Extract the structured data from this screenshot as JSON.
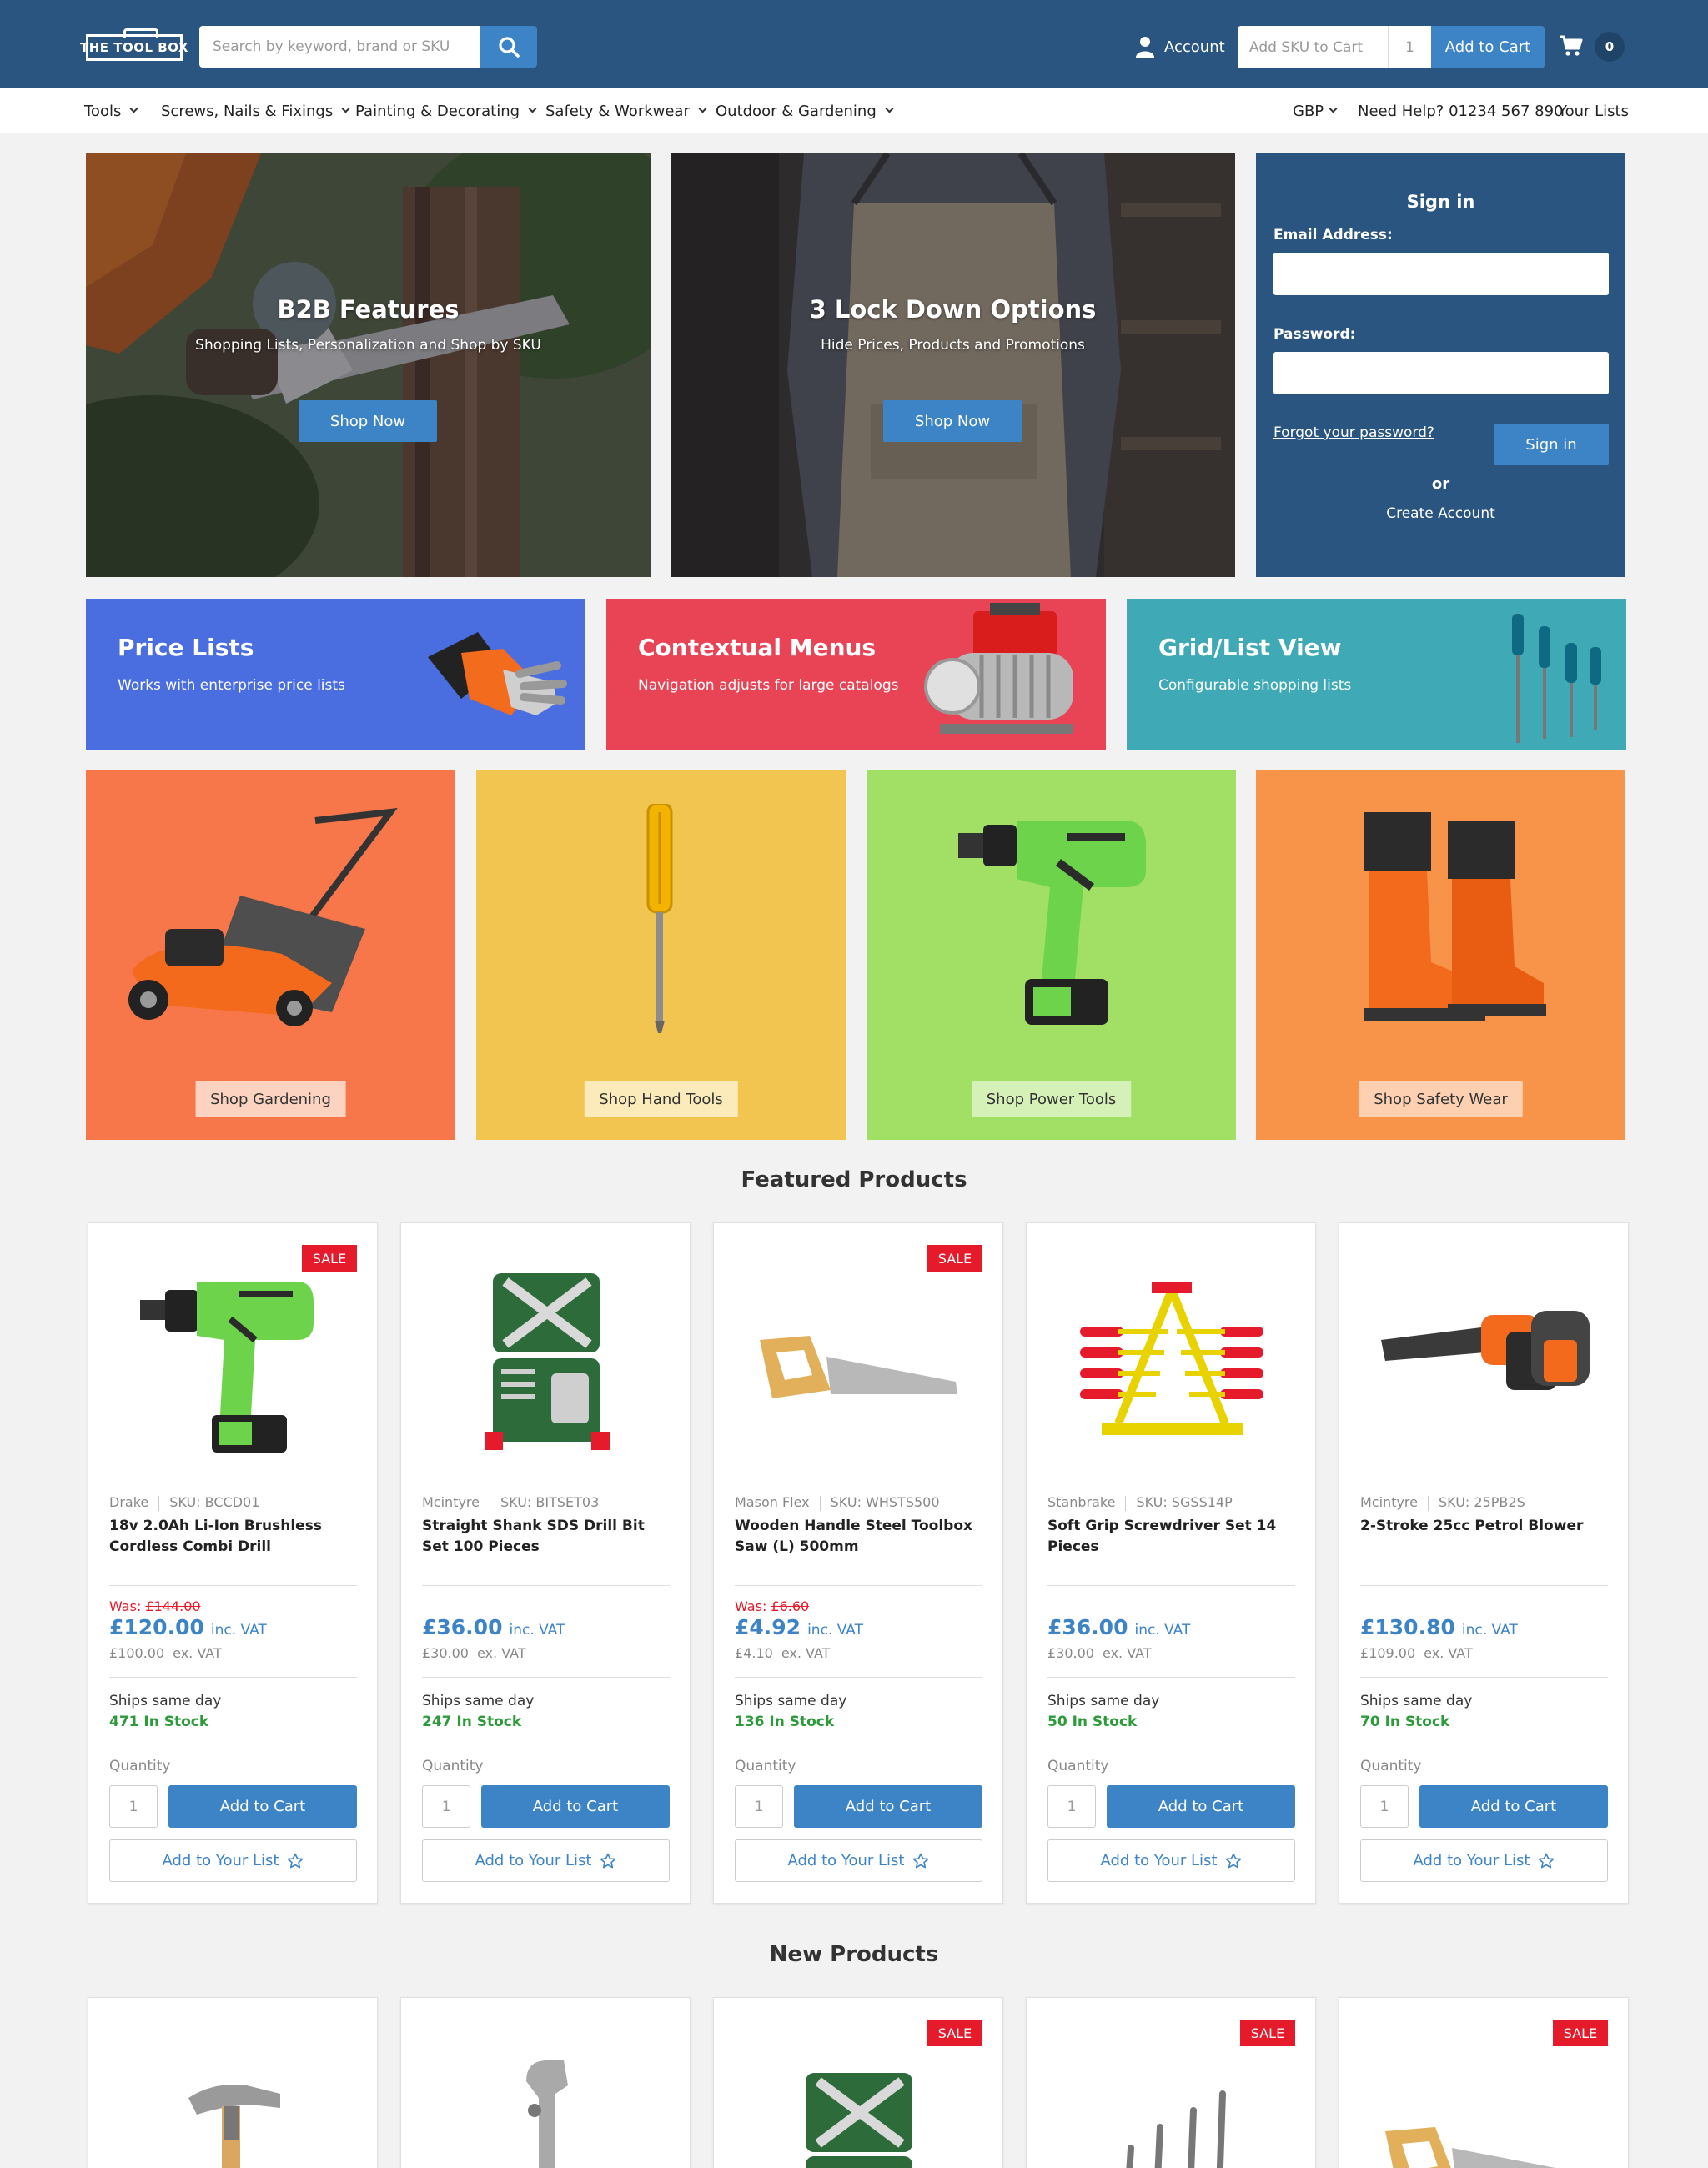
{
  "header": {
    "logo_text": "THE TOOL BOX",
    "search_placeholder": "Search by keyword, brand or SKU",
    "account_label": "Account",
    "sku_placeholder": "Add SKU to Cart",
    "sku_qty": "1",
    "add_to_cart_label": "Add to Cart",
    "cart_count": "0"
  },
  "nav": {
    "items": [
      "Tools",
      "Screws, Nails & Fixings",
      "Painting & Decorating",
      "Safety & Workwear",
      "Outdoor & Gardening"
    ],
    "currency": "GBP",
    "help": "Need Help? 01234 567 890",
    "lists": "Your Lists"
  },
  "heroes": [
    {
      "title": "B2B Features",
      "subtitle": "Shopping Lists, Personalization and Shop by SKU",
      "button": "Shop Now"
    },
    {
      "title": "3 Lock Down Options",
      "subtitle": "Hide Prices, Products and Promotions",
      "button": "Shop Now"
    }
  ],
  "signin": {
    "title": "Sign in",
    "email_label": "Email Address:",
    "password_label": "Password:",
    "forgot": "Forgot your password?",
    "button": "Sign in",
    "or": "or",
    "create": "Create Account"
  },
  "promos": [
    {
      "title": "Price Lists",
      "subtitle": "Works with enterprise price lists",
      "color": "#4a6de0"
    },
    {
      "title": "Contextual Menus",
      "subtitle": "Navigation adjusts for large catalogs",
      "color": "#e84456"
    },
    {
      "title": "Grid/List View",
      "subtitle": "Configurable shopping lists",
      "color": "#3fa9b5"
    }
  ],
  "categories": [
    {
      "label": "Shop Gardening",
      "color": "#f7774b"
    },
    {
      "label": "Shop Hand Tools",
      "color": "#f2c551"
    },
    {
      "label": "Shop Power Tools",
      "color": "#a2e065"
    },
    {
      "label": "Shop Safety Wear",
      "color": "#f8944a"
    }
  ],
  "featured_title": "Featured Products",
  "new_title": "New Products",
  "sale_label": "SALE",
  "quantity_label": "Quantity",
  "add_list_label": "Add to Your List",
  "products": [
    {
      "brand": "Drake",
      "sku": "SKU: BCCD01",
      "name": "18v 2.0Ah Li-Ion Brushless Cordless Combi Drill",
      "sale": true,
      "was": "£144.00",
      "price": "£120.00",
      "inc": "inc. VAT",
      "ex_price": "£100.00",
      "ex": "ex. VAT",
      "ship": "Ships same day",
      "stock": "471 In Stock",
      "qty": "1"
    },
    {
      "brand": "Mcintyre",
      "sku": "SKU: BITSET03",
      "name": "Straight Shank SDS Drill Bit Set 100 Pieces",
      "sale": false,
      "was": "",
      "price": "£36.00",
      "inc": "inc. VAT",
      "ex_price": "£30.00",
      "ex": "ex. VAT",
      "ship": "Ships same day",
      "stock": "247 In Stock",
      "qty": "1"
    },
    {
      "brand": "Mason Flex",
      "sku": "SKU: WHSTS500",
      "name": "Wooden Handle Steel Toolbox Saw (L) 500mm",
      "sale": true,
      "was": "£6.60",
      "price": "£4.92",
      "inc": "inc. VAT",
      "ex_price": "£4.10",
      "ex": "ex. VAT",
      "ship": "Ships same day",
      "stock": "136 In Stock",
      "qty": "1"
    },
    {
      "brand": "Stanbrake",
      "sku": "SKU: SGSS14P",
      "name": "Soft Grip Screwdriver Set 14 Pieces",
      "sale": false,
      "was": "",
      "price": "£36.00",
      "inc": "inc. VAT",
      "ex_price": "£30.00",
      "ex": "ex. VAT",
      "ship": "Ships same day",
      "stock": "50 In Stock",
      "qty": "1"
    },
    {
      "brand": "Mcintyre",
      "sku": "SKU: 25PB2S",
      "name": "2-Stroke 25cc Petrol Blower",
      "sale": false,
      "was": "",
      "price": "£130.80",
      "inc": "inc. VAT",
      "ex_price": "£109.00",
      "ex": "ex. VAT",
      "ship": "Ships same day",
      "stock": "70 In Stock",
      "qty": "1"
    }
  ],
  "new_products": [
    {
      "sale": false
    },
    {
      "sale": false
    },
    {
      "sale": true
    },
    {
      "sale": true
    },
    {
      "sale": true
    }
  ]
}
